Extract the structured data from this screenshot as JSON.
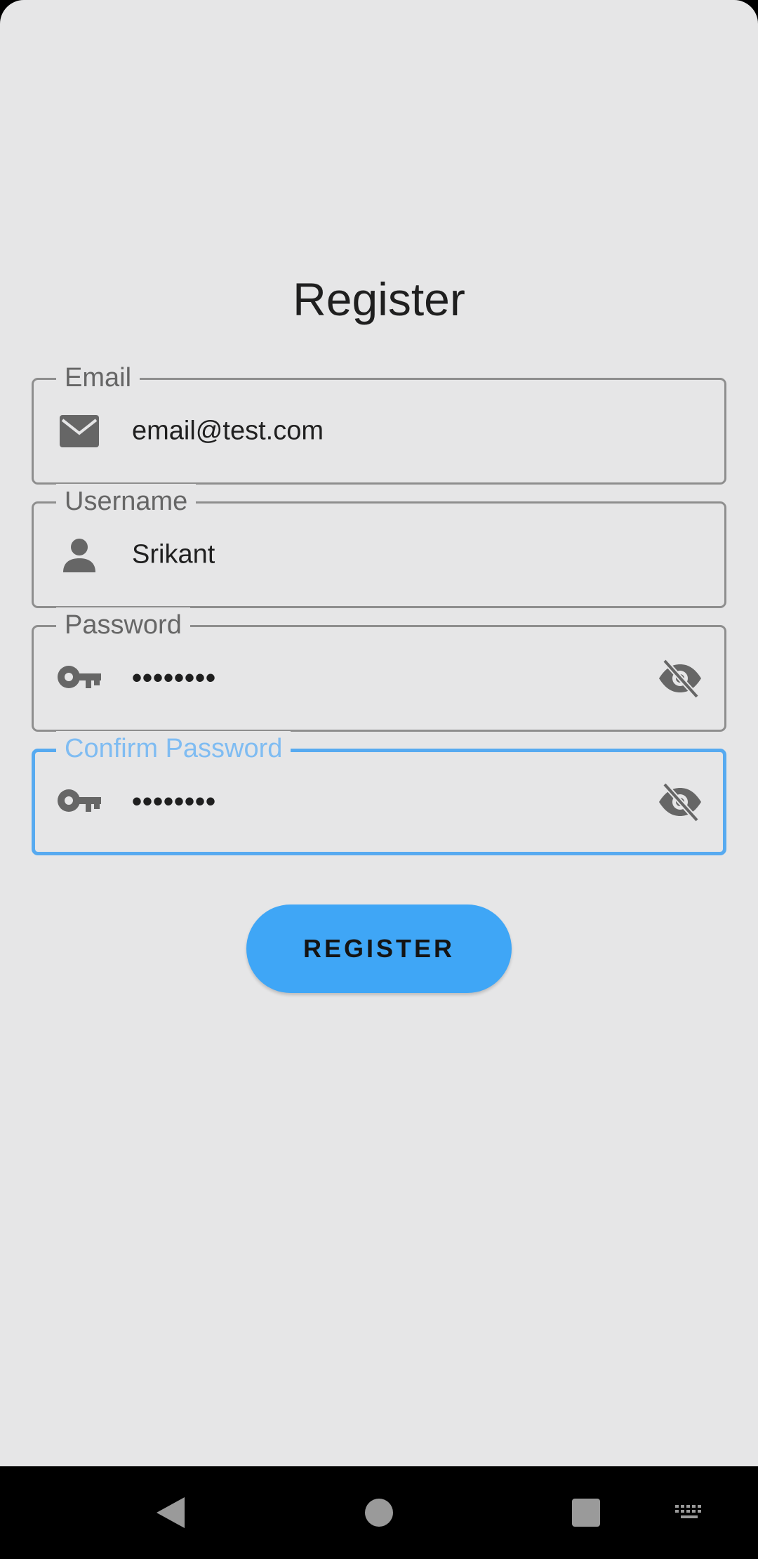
{
  "page": {
    "title": "Register"
  },
  "form": {
    "email": {
      "label": "Email",
      "value": "email@test.com",
      "icon": "email-icon"
    },
    "username": {
      "label": "Username",
      "value": "Srikant",
      "icon": "person-icon"
    },
    "password": {
      "label": "Password",
      "value": "••••••••",
      "icon": "key-icon",
      "toggle_icon": "visibility-off-icon"
    },
    "confirm_password": {
      "label": "Confirm Password",
      "value": "••••••••",
      "icon": "key-icon",
      "toggle_icon": "visibility-off-icon",
      "focused": true
    }
  },
  "actions": {
    "register_label": "REGISTER"
  },
  "navbar": {
    "items": [
      "back-icon",
      "home-icon",
      "recents-icon",
      "keyboard-icon"
    ]
  },
  "colors": {
    "accent": "#3fa6f6",
    "focus_border": "#57aaf0",
    "background": "#e6e6e7"
  }
}
